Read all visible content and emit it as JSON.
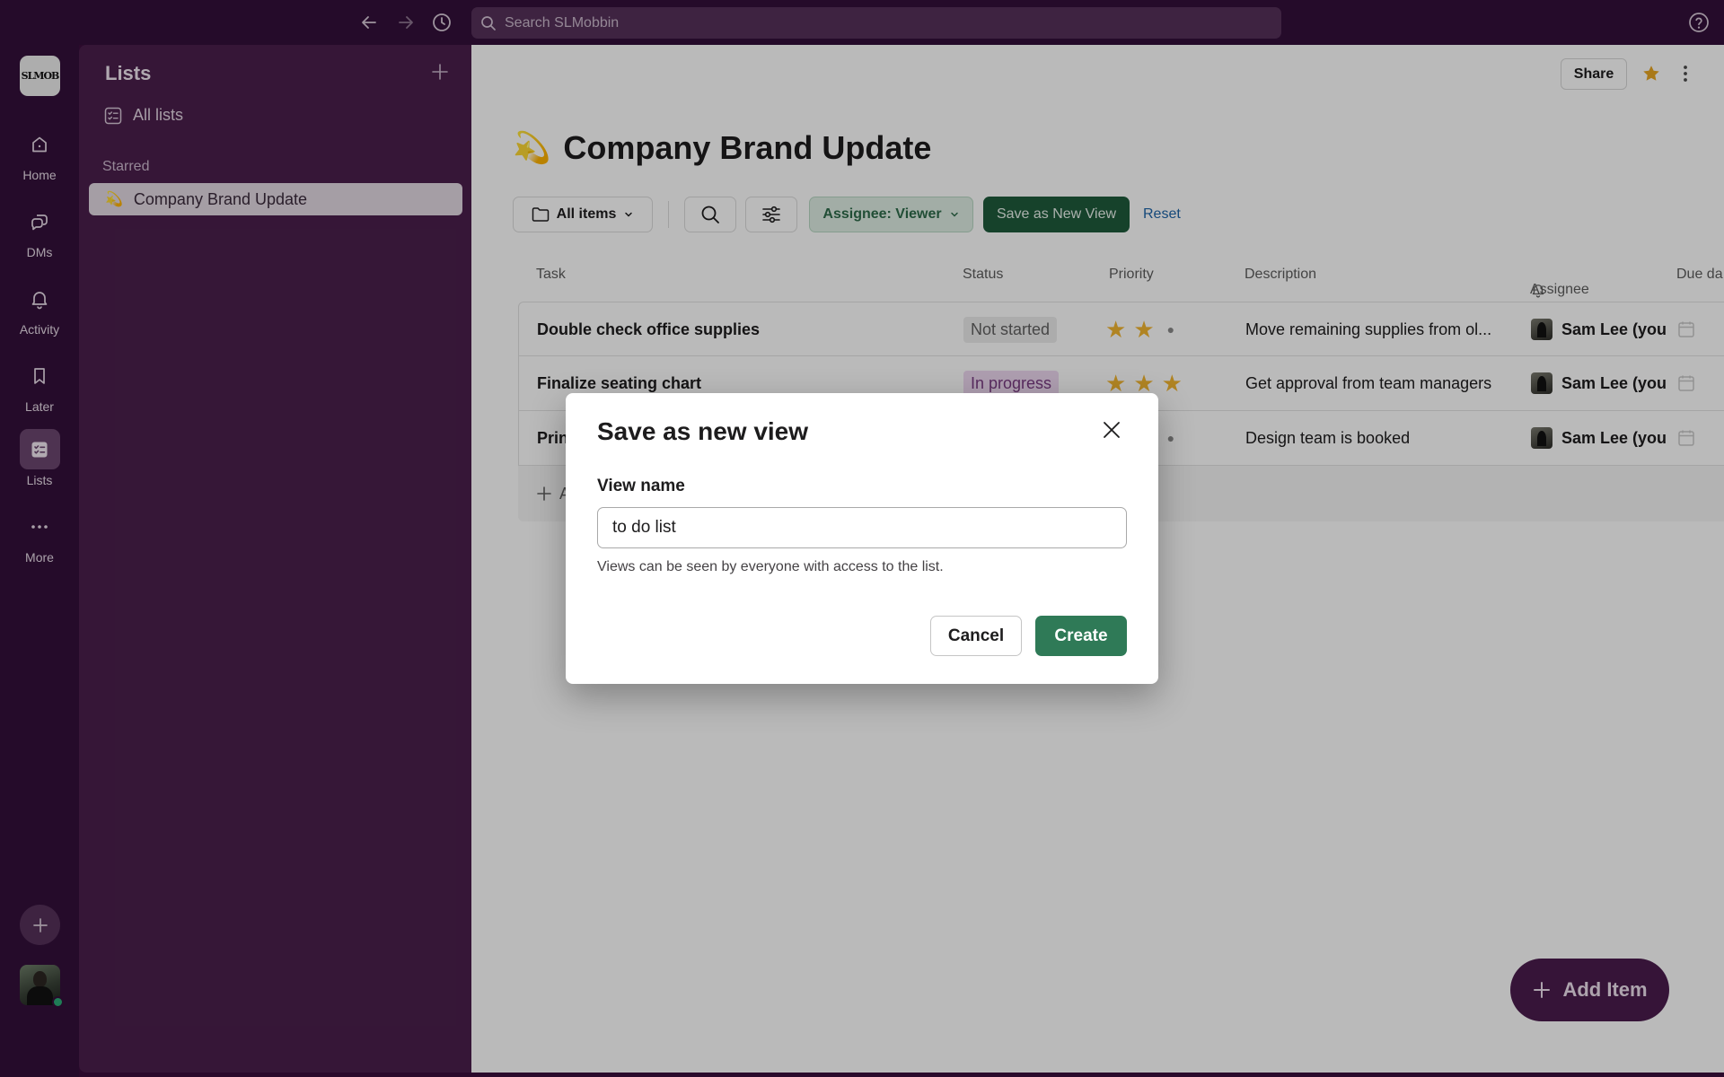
{
  "search": {
    "placeholder": "Search SLMobbin"
  },
  "workspace": {
    "logo_text": "SLMOB"
  },
  "rail": {
    "items": [
      {
        "label": "Home",
        "icon": "home-icon"
      },
      {
        "label": "DMs",
        "icon": "dms-icon"
      },
      {
        "label": "Activity",
        "icon": "bell-icon"
      },
      {
        "label": "Later",
        "icon": "bookmark-icon"
      },
      {
        "label": "Lists",
        "icon": "lists-icon",
        "active": true
      },
      {
        "label": "More",
        "icon": "more-icon"
      }
    ]
  },
  "sidebar": {
    "title": "Lists",
    "all_lists": "All lists",
    "section_starred": "Starred",
    "starred_item": {
      "emoji": "💫",
      "label": "Company Brand Update"
    }
  },
  "header": {
    "share_label": "Share"
  },
  "page": {
    "emoji": "💫",
    "title": "Company Brand Update"
  },
  "toolbar": {
    "all_items": "All items",
    "assignee_filter": "Assignee: Viewer",
    "save_view": "Save as New View",
    "reset": "Reset"
  },
  "table": {
    "columns": {
      "task": "Task",
      "status": "Status",
      "priority": "Priority",
      "description": "Description",
      "assignee": "Assignee",
      "due": "Due da"
    },
    "rows": [
      {
        "task": "Double check office supplies",
        "status": "Not started",
        "priority": 2,
        "description": "Move remaining supplies from ol...",
        "assignee": "Sam Lee (you"
      },
      {
        "task": "Finalize seating chart",
        "status": "In progress",
        "priority": 3,
        "description": "Get approval from team managers",
        "assignee": "Sam Lee (you"
      },
      {
        "task": "Prin",
        "status": "",
        "priority": 2,
        "description": "Design team is booked",
        "assignee": "Sam Lee (you"
      }
    ],
    "add_row_label": "A"
  },
  "fab": {
    "label": "Add Item"
  },
  "modal": {
    "title": "Save as new view",
    "field_label": "View name",
    "field_value": "to do list",
    "hint": "Views can be seen by everyone with access to the list.",
    "cancel": "Cancel",
    "create": "Create"
  },
  "colors": {
    "accent_green": "#2f7a57",
    "sidebar_purple": "#4a1f4c",
    "star": "#f2b531"
  }
}
